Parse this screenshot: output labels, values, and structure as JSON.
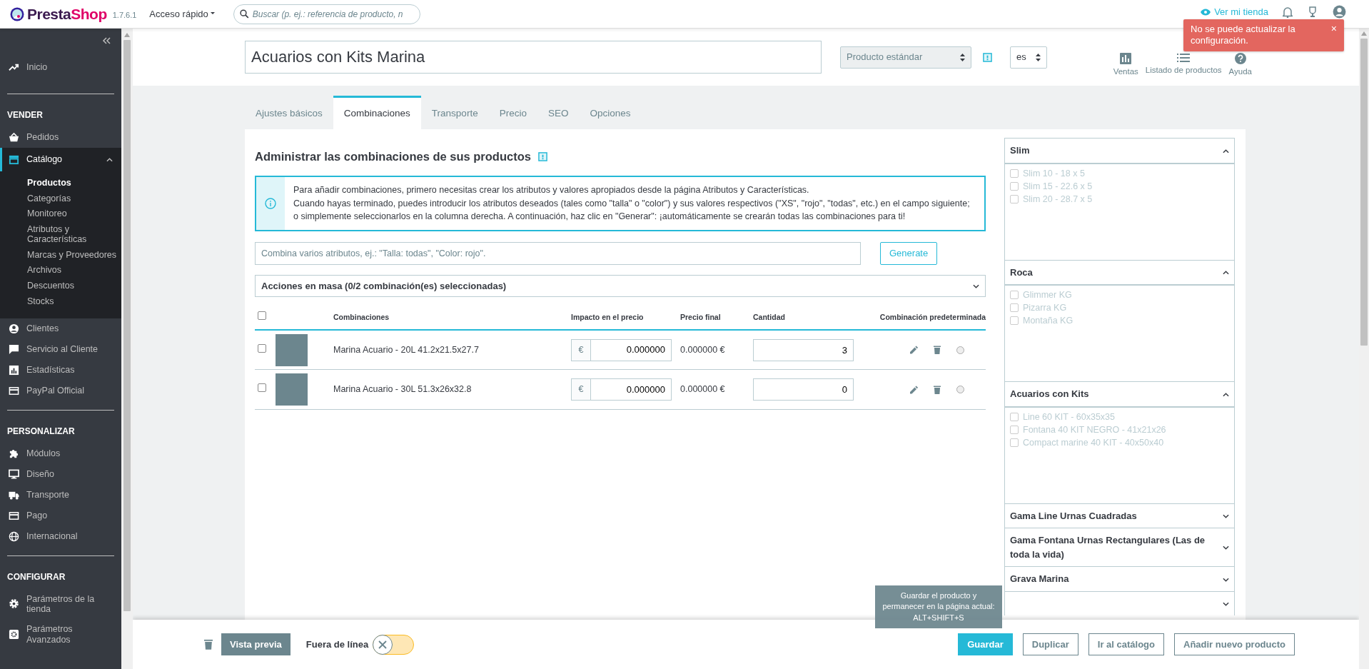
{
  "header": {
    "logo": [
      "Presta",
      "Shop"
    ],
    "version": "1.7.6.1",
    "quick_access": "Acceso rápido",
    "search": {
      "placeholder": "Buscar (p. ej.: referencia de producto, n"
    },
    "view_shop": "Ver mi tienda"
  },
  "notification": {
    "text": "No se puede actualizar la configuración.",
    "close": "×"
  },
  "sidebar": {
    "sections": [
      {
        "items": [
          {
            "label": "Inicio",
            "selected": false
          }
        ]
      },
      {
        "title": "VENDER",
        "items": [
          {
            "label": "Pedidos",
            "selected": false
          },
          {
            "label": "Catálogo",
            "selected": true,
            "expanded": true,
            "children": [
              {
                "label": "Productos",
                "selected": true
              },
              {
                "label": "Categorías",
                "selected": false
              },
              {
                "label": "Monitoreo",
                "selected": false
              },
              {
                "label": "Atributos y Características",
                "selected": false
              },
              {
                "label": "Marcas y Proveedores",
                "selected": false
              },
              {
                "label": "Archivos",
                "selected": false
              },
              {
                "label": "Descuentos",
                "selected": false
              },
              {
                "label": "Stocks",
                "selected": false
              }
            ]
          },
          {
            "label": "Clientes",
            "selected": false
          },
          {
            "label": "Servicio al Cliente",
            "selected": false
          },
          {
            "label": "Estadísticas",
            "selected": false
          },
          {
            "label": "PayPal Official",
            "selected": false
          }
        ]
      },
      {
        "title": "PERSONALIZAR",
        "items": [
          {
            "label": "Módulos",
            "selected": false
          },
          {
            "label": "Diseño",
            "selected": false
          },
          {
            "label": "Transporte",
            "selected": false
          },
          {
            "label": "Pago",
            "selected": false
          },
          {
            "label": "Internacional",
            "selected": false
          }
        ]
      },
      {
        "title": "CONFIGURAR",
        "items": [
          {
            "label": "Parámetros de la tienda",
            "selected": false
          },
          {
            "label": "Parámetros Avanzados",
            "selected": false
          }
        ]
      }
    ]
  },
  "product": {
    "name": "Acuarios con Kits Marina",
    "type": "Producto estándar",
    "language": "es",
    "actions": [
      {
        "label": "Ventas"
      },
      {
        "label": "Listado de productos"
      },
      {
        "label": "Ayuda"
      }
    ]
  },
  "tabs": [
    {
      "label": "Ajustes básicos",
      "selected": false
    },
    {
      "label": "Combinaciones",
      "selected": true
    },
    {
      "label": "Transporte",
      "selected": false
    },
    {
      "label": "Precio",
      "selected": false
    },
    {
      "label": "SEO",
      "selected": false
    },
    {
      "label": "Opciones",
      "selected": false
    }
  ],
  "combinations": {
    "title": "Administrar las combinaciones de sus productos",
    "info": [
      "Para añadir combinaciones, primero necesitas crear los atributos y valores apropiados desde la página Atributos y Características.",
      "Cuando hayas terminado, puedes introducir los atributos deseados (tales como \"talla\" o \"color\") y sus valores respectivos (\"XS\", \"rojo\", \"todas\", etc.) en el campo siguiente; o simplemente seleccionarlos en la columna derecha. A continuación, haz clic en \"Generar\": ¡automáticamente se crearán todas las combinaciones para ti!"
    ],
    "combine_placeholder": "Combina varios atributos, ej.: \"Talla: todas\", \"Color: rojo\".",
    "generate": "Generate",
    "bulk_actions": "Acciones en masa (0/2 combinación(es) seleccionadas)",
    "select_all": false,
    "columns": [
      "Combinaciones",
      "Impacto en el precio",
      "Precio final",
      "Cantidad",
      "Combinación predeterminada"
    ],
    "rows": [
      {
        "selected": false,
        "name": "Marina Acuario - 20L 41.2x21.5x27.7",
        "currency": "€",
        "impact": "0.000000",
        "final_price": "0.000000 €",
        "quantity": "3",
        "default": false
      },
      {
        "selected": false,
        "name": "Marina Acuario - 30L 51.3x26x32.8",
        "currency": "€",
        "impact": "0.000000",
        "final_price": "0.000000 €",
        "quantity": "0",
        "default": false
      }
    ]
  },
  "attribute_groups": [
    {
      "title": "Slim",
      "expanded": true,
      "options": [
        {
          "label": "Slim 10 - 18 x 5",
          "checked": false
        },
        {
          "label": "Slim 15 - 22.6 x 5",
          "checked": false
        },
        {
          "label": "Slim 20 - 28.7 x 5",
          "checked": false
        }
      ]
    },
    {
      "title": "Roca",
      "expanded": true,
      "options": [
        {
          "label": "Glimmer KG",
          "checked": false
        },
        {
          "label": "Pizarra KG",
          "checked": false
        },
        {
          "label": "Montaña KG",
          "checked": false
        }
      ]
    },
    {
      "title": "Acuarios con Kits",
      "expanded": true,
      "options": [
        {
          "label": "Line 60 KIT - 60x35x35",
          "checked": false
        },
        {
          "label": "Fontana 40 KIT NEGRO - 41x21x26",
          "checked": false
        },
        {
          "label": "Compact marine 40 KIT - 40x50x40",
          "checked": false
        }
      ]
    },
    {
      "title": "Gama Line Urnas Cuadradas",
      "expanded": false
    },
    {
      "title": "Gama Fontana Urnas Rectangulares (Las de toda la vida)",
      "expanded": false
    },
    {
      "title": "Grava Marina",
      "expanded": false
    },
    {
      "expanded": false
    }
  ],
  "footer": {
    "preview": "Vista previa",
    "offline_label": "Fuera de línea",
    "online": false,
    "buttons": [
      {
        "label": "Guardar",
        "kind": "primary"
      },
      {
        "label": "Duplicar",
        "kind": "outline"
      },
      {
        "label": "Ir al catálogo",
        "kind": "outline"
      },
      {
        "label": "Añadir nuevo producto",
        "kind": "outline"
      }
    ],
    "tooltip": "Guardar el producto y permanecer en la página actual: ALT+SHIFT+S"
  }
}
